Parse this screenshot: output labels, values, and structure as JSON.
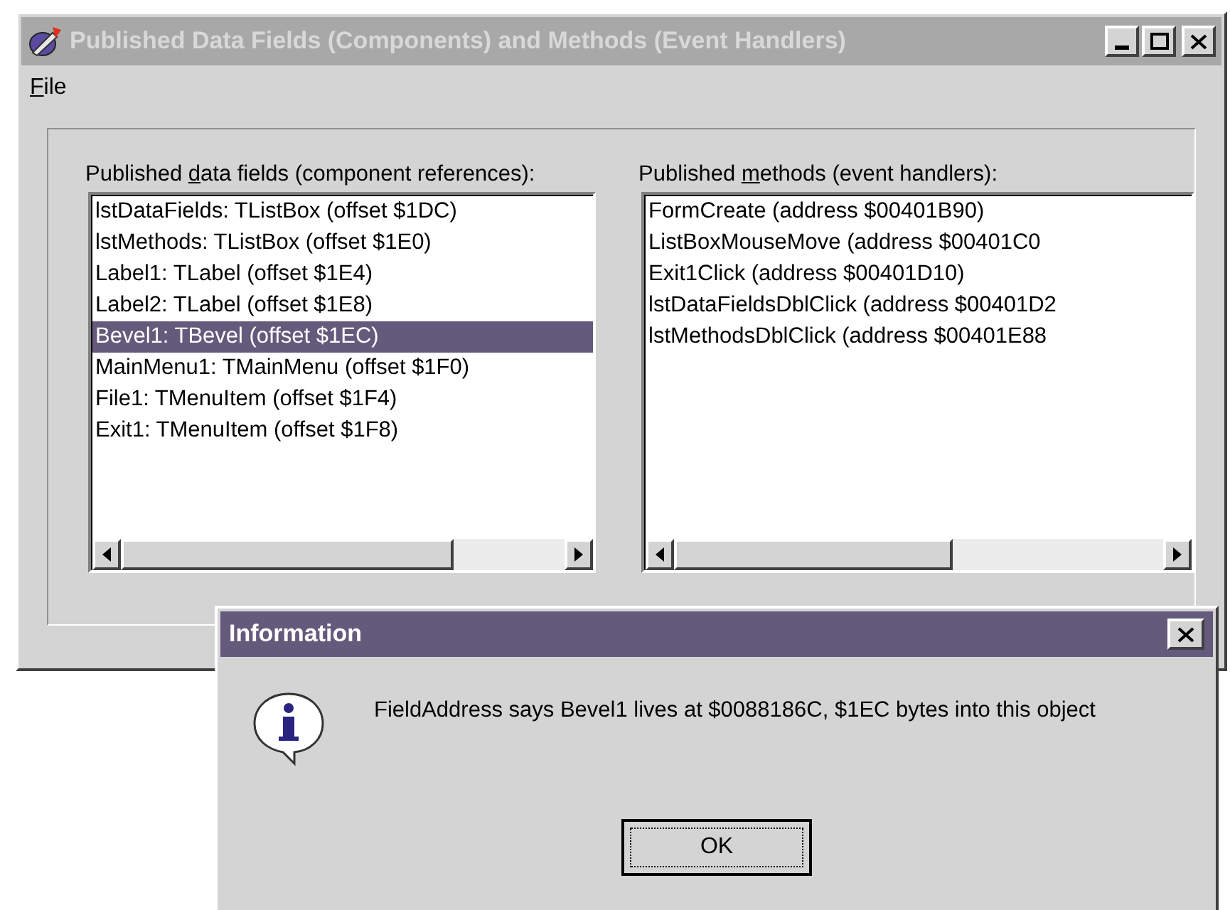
{
  "window": {
    "title": "Published Data Fields (Components) and Methods (Event Handlers)",
    "active": false
  },
  "menu": [
    {
      "key": "F",
      "post": "ile"
    }
  ],
  "panels": [
    {
      "label": {
        "pre": "Published ",
        "key": "d",
        "post": "ata fields (component references):"
      },
      "items": [
        {
          "text": "lstDataFields: TListBox (offset $1DC)",
          "selected": false
        },
        {
          "text": "lstMethods: TListBox (offset $1E0)",
          "selected": false
        },
        {
          "text": "Label1: TLabel (offset $1E4)",
          "selected": false
        },
        {
          "text": "Label2: TLabel (offset $1E8)",
          "selected": false
        },
        {
          "text": "Bevel1: TBevel (offset $1EC)",
          "selected": true
        },
        {
          "text": "MainMenu1: TMainMenu (offset $1F0)",
          "selected": false
        },
        {
          "text": "File1: TMenuItem (offset $1F4)",
          "selected": false
        },
        {
          "text": "Exit1: TMenuItem (offset $1F8)",
          "selected": false
        }
      ]
    },
    {
      "label": {
        "pre": "Published ",
        "key": "m",
        "post": "ethods (event handlers):"
      },
      "items": [
        {
          "text": "FormCreate (address $00401B90)",
          "selected": false
        },
        {
          "text": "ListBoxMouseMove (address $00401C0",
          "selected": false
        },
        {
          "text": "Exit1Click (address $00401D10)",
          "selected": false
        },
        {
          "text": "lstDataFieldsDblClick (address $00401D2",
          "selected": false
        },
        {
          "text": "lstMethodsDblClick (address $00401E88",
          "selected": false
        }
      ]
    }
  ],
  "dialog": {
    "title": "Information",
    "message": "FieldAddress says Bevel1 lives at $0088186C, $1EC bytes into this object",
    "button": {
      "label": "OK",
      "focused": true
    }
  }
}
